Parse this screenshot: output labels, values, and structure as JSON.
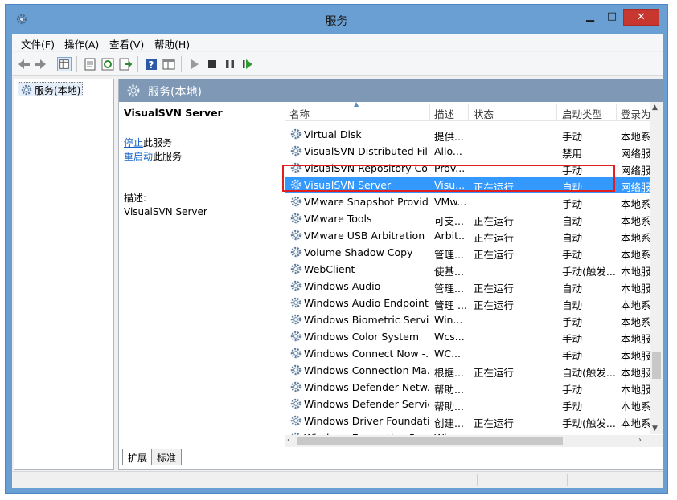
{
  "window": {
    "title": "服务"
  },
  "menu": [
    {
      "label": "文件(F)"
    },
    {
      "label": "操作(A)"
    },
    {
      "label": "查看(V)"
    },
    {
      "label": "帮助(H)"
    }
  ],
  "toolbar": {
    "buttons": [
      "back-icon",
      "forward-icon",
      "show-hide-tree-icon",
      "properties-icon",
      "refresh-icon",
      "export-list-icon",
      "help-icon",
      "view-icon",
      "start-service-icon",
      "stop-service-icon",
      "pause-service-icon",
      "restart-service-icon"
    ]
  },
  "tree": {
    "root_label": "服务(本地)"
  },
  "panel": {
    "header_title": "服务(本地)",
    "selected_service_name": "VisualSVN Server",
    "stop_link": "停止",
    "stop_suffix": "此服务",
    "restart_link": "重启动",
    "restart_suffix": "此服务",
    "desc_label": "描述:",
    "desc_value": "VisualSVN Server"
  },
  "columns": {
    "name": "名称",
    "desc": "描述",
    "status": "状态",
    "startup": "启动类型",
    "logon": "登录为"
  },
  "rows": [
    {
      "name": "Virtual Disk",
      "desc": "提供...",
      "status": "",
      "startup": "手动",
      "logon": "本地系",
      "selected": false
    },
    {
      "name": "VisualSVN Distributed Fil...",
      "desc": "Allo...",
      "status": "",
      "startup": "禁用",
      "logon": "网络服",
      "selected": false
    },
    {
      "name": "VisualSVN Repository Co...",
      "desc": "Prov...",
      "status": "",
      "startup": "手动",
      "logon": "网络服",
      "selected": false
    },
    {
      "name": "VisualSVN Server",
      "desc": "Visu...",
      "status": "正在运行",
      "startup": "自动",
      "logon": "网络服",
      "selected": true
    },
    {
      "name": "VMware Snapshot Provid...",
      "desc": "VMw...",
      "status": "",
      "startup": "手动",
      "logon": "本地系",
      "selected": false
    },
    {
      "name": "VMware Tools",
      "desc": "可支...",
      "status": "正在运行",
      "startup": "自动",
      "logon": "本地系",
      "selected": false
    },
    {
      "name": "VMware USB Arbitration ...",
      "desc": "Arbit...",
      "status": "正在运行",
      "startup": "自动",
      "logon": "本地系",
      "selected": false
    },
    {
      "name": "Volume Shadow Copy",
      "desc": "管理...",
      "status": "正在运行",
      "startup": "手动",
      "logon": "本地系",
      "selected": false
    },
    {
      "name": "WebClient",
      "desc": "使基...",
      "status": "",
      "startup": "手动(触发...",
      "logon": "本地服",
      "selected": false
    },
    {
      "name": "Windows Audio",
      "desc": "管理...",
      "status": "正在运行",
      "startup": "自动",
      "logon": "本地服",
      "selected": false
    },
    {
      "name": "Windows Audio Endpoint...",
      "desc": "管理 ...",
      "status": "正在运行",
      "startup": "自动",
      "logon": "本地系",
      "selected": false
    },
    {
      "name": "Windows Biometric Servi...",
      "desc": "Win...",
      "status": "",
      "startup": "手动",
      "logon": "本地系",
      "selected": false
    },
    {
      "name": "Windows Color System",
      "desc": "Wcs...",
      "status": "",
      "startup": "手动",
      "logon": "本地服",
      "selected": false
    },
    {
      "name": "Windows Connect Now -...",
      "desc": "WC...",
      "status": "",
      "startup": "手动",
      "logon": "本地服",
      "selected": false
    },
    {
      "name": "Windows Connection Ma...",
      "desc": "根据...",
      "status": "正在运行",
      "startup": "自动(触发...",
      "logon": "本地服",
      "selected": false
    },
    {
      "name": "Windows Defender Netw...",
      "desc": "帮助...",
      "status": "",
      "startup": "手动",
      "logon": "本地服",
      "selected": false
    },
    {
      "name": "Windows Defender Service",
      "desc": "帮助...",
      "status": "",
      "startup": "手动",
      "logon": "本地系",
      "selected": false
    },
    {
      "name": "Windows Driver Foundati...",
      "desc": "创建...",
      "status": "正在运行",
      "startup": "手动(触发...",
      "logon": "本地系",
      "selected": false
    },
    {
      "name": "Windows Encryption Pro...",
      "desc": "Win...",
      "status": "",
      "startup": "手动(触发...",
      "logon": "本地服",
      "selected": false
    }
  ],
  "tabs": [
    {
      "label": "扩展",
      "active": true
    },
    {
      "label": "标准",
      "active": false
    }
  ],
  "colors": {
    "selection": "#3399ff",
    "link": "#1463c7",
    "highlight_box": "#e02020",
    "panel_header": "#7e98b5"
  }
}
